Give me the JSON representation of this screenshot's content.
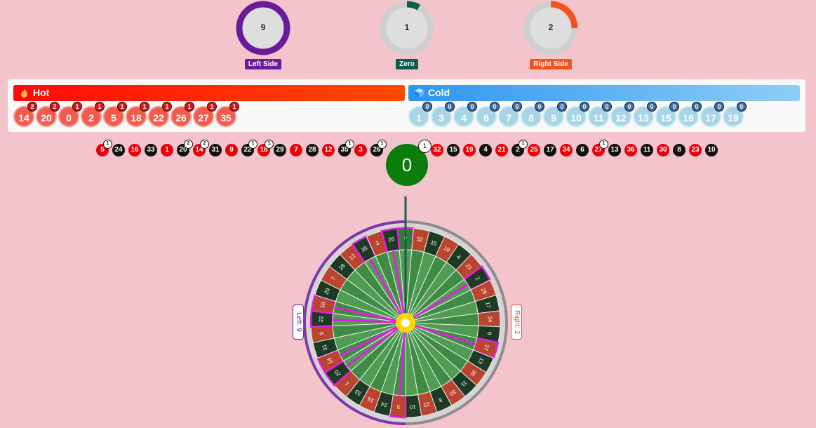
{
  "gauges": [
    {
      "value": "9",
      "label": "Left Side",
      "color": "#6a1b9a",
      "fraction": 1.0
    },
    {
      "value": "1",
      "label": "Zero",
      "color": "#0b5e4f",
      "fraction": 0.083
    },
    {
      "value": "2",
      "label": "Right Side",
      "color": "#f4511e",
      "fraction": 0.25
    }
  ],
  "hot": {
    "title": "Hot",
    "icon": "fire-icon",
    "numbers": [
      {
        "n": "14",
        "c": "2"
      },
      {
        "n": "20",
        "c": "2"
      },
      {
        "n": "0",
        "c": "1"
      },
      {
        "n": "2",
        "c": "1"
      },
      {
        "n": "5",
        "c": "1"
      },
      {
        "n": "18",
        "c": "1"
      },
      {
        "n": "22",
        "c": "1"
      },
      {
        "n": "26",
        "c": "1"
      },
      {
        "n": "27",
        "c": "1"
      },
      {
        "n": "35",
        "c": "1"
      }
    ]
  },
  "cold": {
    "title": "Cold",
    "icon": "cube-icon",
    "numbers": [
      {
        "n": "1",
        "c": "0"
      },
      {
        "n": "3",
        "c": "0"
      },
      {
        "n": "4",
        "c": "0"
      },
      {
        "n": "6",
        "c": "0"
      },
      {
        "n": "7",
        "c": "0"
      },
      {
        "n": "8",
        "c": "0"
      },
      {
        "n": "9",
        "c": "0"
      },
      {
        "n": "10",
        "c": "0"
      },
      {
        "n": "11",
        "c": "0"
      },
      {
        "n": "12",
        "c": "0"
      },
      {
        "n": "13",
        "c": "0"
      },
      {
        "n": "15",
        "c": "0"
      },
      {
        "n": "16",
        "c": "0"
      },
      {
        "n": "17",
        "c": "0"
      },
      {
        "n": "19",
        "c": "0"
      }
    ]
  },
  "history_left": [
    {
      "n": "5",
      "col": "red",
      "b": "1"
    },
    {
      "n": "24",
      "col": "black"
    },
    {
      "n": "16",
      "col": "red"
    },
    {
      "n": "33",
      "col": "black"
    },
    {
      "n": "1",
      "col": "red"
    },
    {
      "n": "20",
      "col": "black",
      "b": "2"
    },
    {
      "n": "14",
      "col": "red",
      "b": "2"
    },
    {
      "n": "31",
      "col": "black"
    },
    {
      "n": "9",
      "col": "red"
    },
    {
      "n": "22",
      "col": "black",
      "b": "1"
    },
    {
      "n": "18",
      "col": "red",
      "b": "1"
    },
    {
      "n": "29",
      "col": "black"
    },
    {
      "n": "7",
      "col": "red"
    },
    {
      "n": "28",
      "col": "black"
    },
    {
      "n": "12",
      "col": "red"
    },
    {
      "n": "35",
      "col": "black",
      "b": "1"
    },
    {
      "n": "3",
      "col": "red"
    },
    {
      "n": "26",
      "col": "black",
      "b": "1"
    }
  ],
  "current": {
    "n": "0",
    "b": "1"
  },
  "history_right": [
    {
      "n": "32",
      "col": "red"
    },
    {
      "n": "15",
      "col": "black"
    },
    {
      "n": "19",
      "col": "red"
    },
    {
      "n": "4",
      "col": "black"
    },
    {
      "n": "21",
      "col": "red"
    },
    {
      "n": "2",
      "col": "black",
      "b": "1"
    },
    {
      "n": "25",
      "col": "red"
    },
    {
      "n": "17",
      "col": "black"
    },
    {
      "n": "34",
      "col": "red"
    },
    {
      "n": "6",
      "col": "black"
    },
    {
      "n": "27",
      "col": "red",
      "b": "1"
    },
    {
      "n": "13",
      "col": "black"
    },
    {
      "n": "36",
      "col": "red"
    },
    {
      "n": "11",
      "col": "black"
    },
    {
      "n": "30",
      "col": "red"
    },
    {
      "n": "8",
      "col": "black"
    },
    {
      "n": "23",
      "col": "red"
    },
    {
      "n": "10",
      "col": "black"
    }
  ],
  "wheel": {
    "order": [
      "0",
      "32",
      "15",
      "19",
      "4",
      "21",
      "2",
      "25",
      "17",
      "34",
      "6",
      "27",
      "13",
      "36",
      "11",
      "30",
      "8",
      "23",
      "10",
      "5",
      "24",
      "16",
      "33",
      "1",
      "20",
      "14",
      "31",
      "9",
      "22",
      "18",
      "29",
      "7",
      "28",
      "12",
      "35",
      "3",
      "26"
    ],
    "highlighted": [
      "0",
      "2",
      "27",
      "5",
      "20",
      "14",
      "22",
      "18",
      "35",
      "26"
    ],
    "left_label": "Left: 9",
    "right_label": "Right: 2"
  },
  "colors": {
    "red": "#e8000b",
    "black": "#111111",
    "green": "#0a7d0a"
  }
}
